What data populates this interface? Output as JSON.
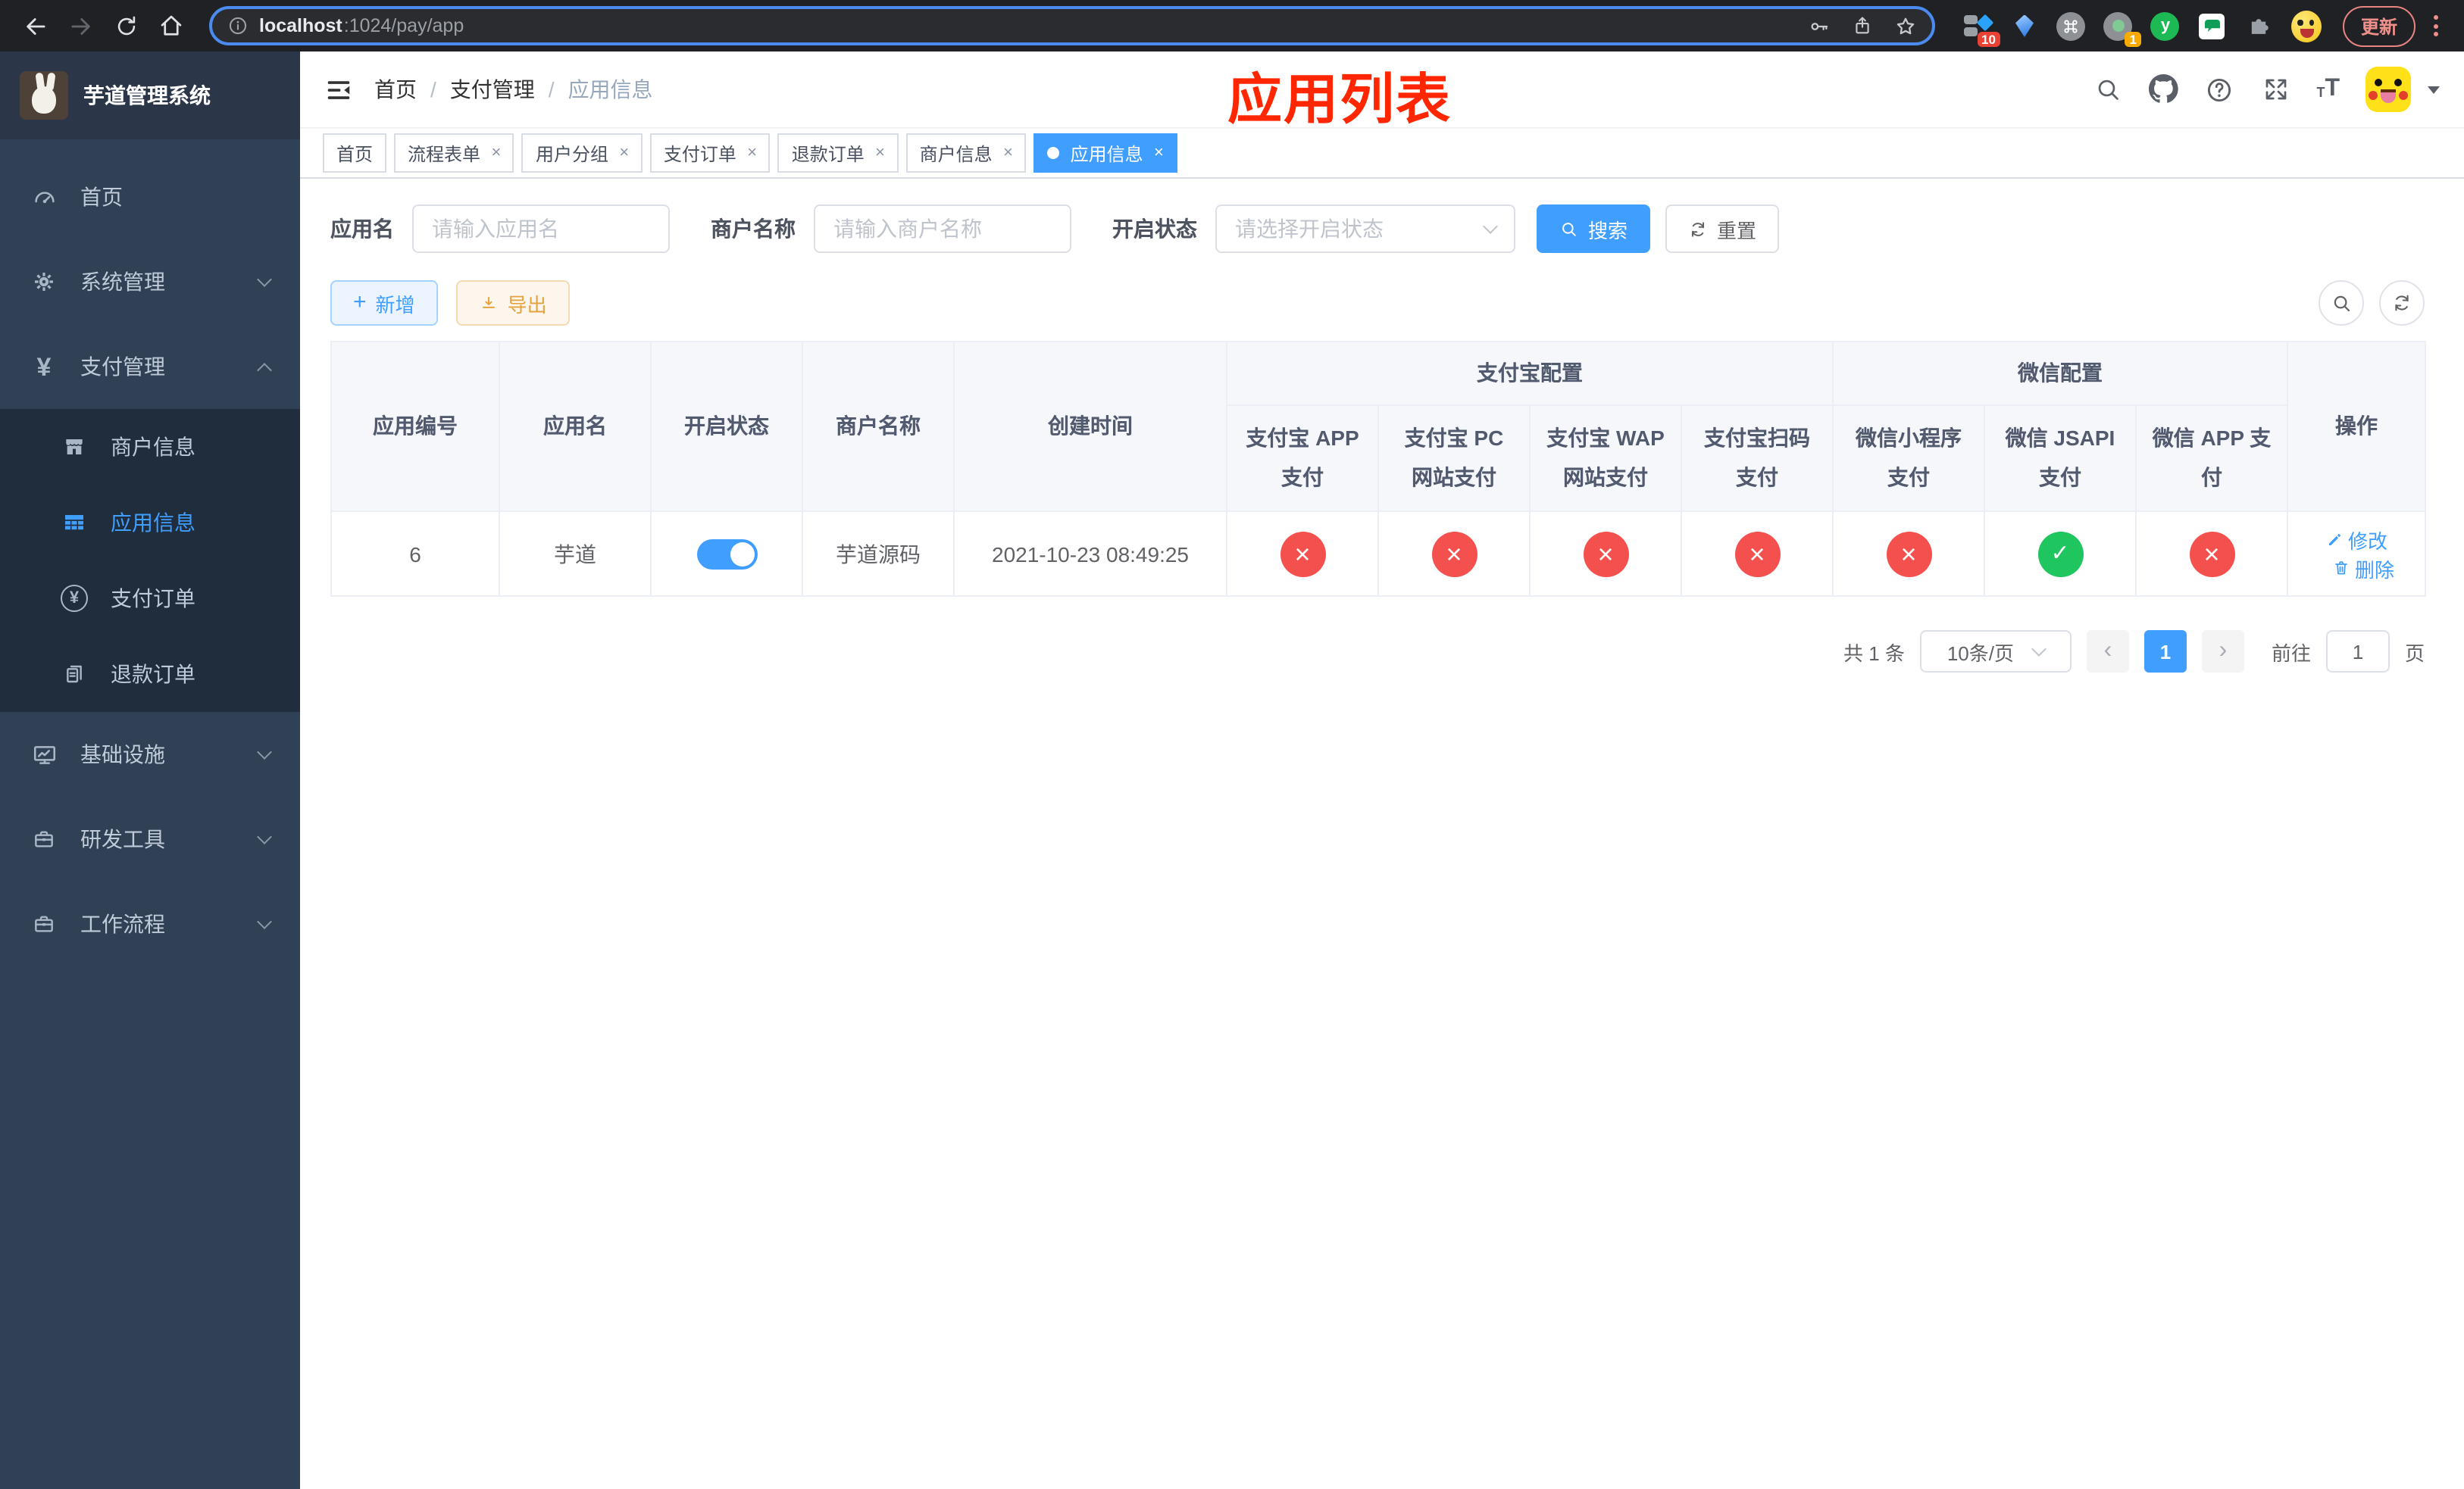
{
  "browser": {
    "url_host": "localhost",
    "url_rest": ":1024/pay/app",
    "update_label": "更新",
    "ext_split_badge": "10",
    "ext_circle_badge": "1",
    "ext_y_letter": "y"
  },
  "sidebar": {
    "title": "芋道管理系统",
    "menu": {
      "home": "首页",
      "system": "系统管理",
      "payment": "支付管理",
      "merchant_info": "商户信息",
      "app_info": "应用信息",
      "pay_order": "支付订单",
      "refund_order": "退款订单",
      "infrastructure": "基础设施",
      "dev_tools": "研发工具",
      "workflow": "工作流程"
    }
  },
  "header": {
    "breadcrumb": [
      "首页",
      "支付管理",
      "应用信息"
    ],
    "overlay_title": "应用列表"
  },
  "tabs": [
    {
      "label": "首页"
    },
    {
      "label": "流程表单"
    },
    {
      "label": "用户分组"
    },
    {
      "label": "支付订单"
    },
    {
      "label": "退款订单"
    },
    {
      "label": "商户信息"
    },
    {
      "label": "应用信息"
    }
  ],
  "filters": {
    "app_name_label": "应用名",
    "app_name_placeholder": "请输入应用名",
    "merchant_label": "商户名称",
    "merchant_placeholder": "请输入商户名称",
    "status_label": "开启状态",
    "status_placeholder": "请选择开启状态",
    "search_label": "搜索",
    "reset_label": "重置"
  },
  "toolbar": {
    "add_label": "新增",
    "export_label": "导出"
  },
  "table": {
    "plain_headers": [
      "应用编号",
      "应用名",
      "开启状态",
      "商户名称",
      "创建时间"
    ],
    "group_alipay": {
      "label": "支付宝配置",
      "children": [
        "支付宝 APP 支付",
        "支付宝 PC 网站支付",
        "支付宝 WAP 网站支付",
        "支付宝扫码支付"
      ]
    },
    "group_wechat": {
      "label": "微信配置",
      "children": [
        "微信小程序支付",
        "微信 JSAPI 支付",
        "微信 APP 支付"
      ]
    },
    "op_header": "操作",
    "rows": [
      {
        "id": "6",
        "name": "芋道",
        "enabled": true,
        "merchant": "芋道源码",
        "created": "2021-10-23 08:49:25",
        "statuses": [
          "fail",
          "fail",
          "fail",
          "fail",
          "fail",
          "pass",
          "fail"
        ],
        "edit_label": "修改",
        "delete_label": "删除"
      }
    ]
  },
  "pagination": {
    "total": "共 1 条",
    "page_size": "10条/页",
    "current_page": "1",
    "goto_label": "前往",
    "goto_value": "1",
    "page_suffix": "页"
  },
  "colors": {
    "accent": "#409eff",
    "sidebar_bg": "#304156",
    "submenu_bg": "#1f2d3d",
    "status_pass": "#1fc65f",
    "status_fail": "#f4504d",
    "overlay_title_red": "#ff2600",
    "export_orange": "#e6a23c",
    "tab_active_bg": "#409eff"
  }
}
